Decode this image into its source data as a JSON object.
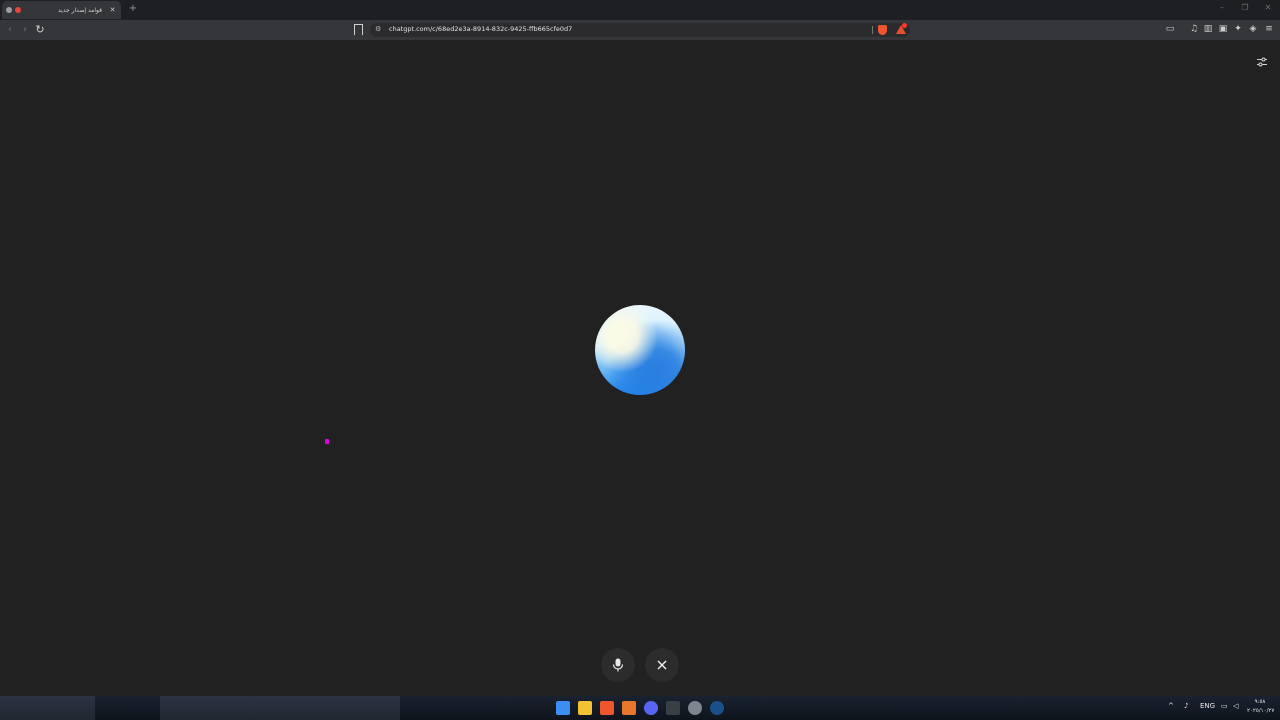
{
  "browser": {
    "tab_title": "قوامد إصدار جديد",
    "tab_close": "✕",
    "new_tab": "+",
    "url": "chatgpt.com/c/68ed2e3a-8914-832c-9425-ffb665cfe0d7",
    "window_controls": [
      "–",
      "❐",
      "✕"
    ],
    "nav": {
      "back": "‹",
      "forward": "›",
      "reload": "↻"
    }
  },
  "toolbar_icons": [
    "media-icon",
    "sidebar-icon",
    "wallet-icon",
    "leo-icon",
    "vpn-icon",
    "menu-icon"
  ],
  "voice": {
    "mic_icon": "microphone-icon",
    "close_icon": "close-icon"
  },
  "taskbar": {
    "apps": [
      "windows-start-icon",
      "file-explorer-icon",
      "brave-icon",
      "app-icon",
      "discord-icon",
      "xbox-icon",
      "chrome-icon",
      "steam-icon"
    ],
    "tray_lang": "ENG",
    "clock_time": "٩:٥٨",
    "clock_date": "٢٠٢٥/١٠/٢٧"
  },
  "colors": {
    "page_bg": "#212121",
    "orb_light": "#fdfbe6",
    "orb_blue": "#1b7fe6",
    "accent_cursor": "#e100e0"
  }
}
